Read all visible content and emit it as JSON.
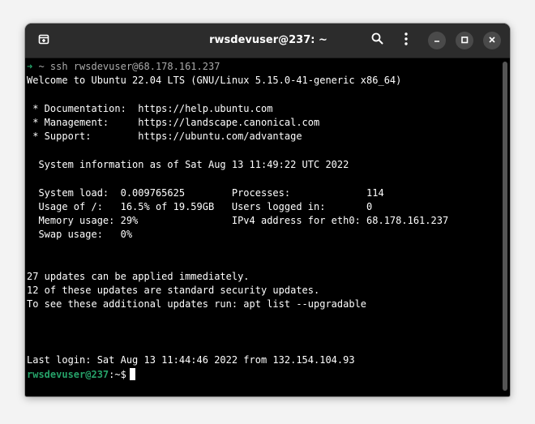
{
  "window": {
    "title": "rwsdevuser@237: ~"
  },
  "terminal": {
    "ssh_arrow": "➜",
    "ssh_command": " ~ ssh rwsdevuser@68.178.161.237",
    "welcome": "Welcome to Ubuntu 22.04 LTS (GNU/Linux 5.15.0-41-generic x86_64)",
    "doc_line": " * Documentation:  https://help.ubuntu.com",
    "mgmt_line": " * Management:     https://landscape.canonical.com",
    "support_line": " * Support:        https://ubuntu.com/advantage",
    "sysinfo_header": "  System information as of Sat Aug 13 11:49:22 UTC 2022",
    "stats_line1": "  System load:  0.009765625        Processes:             114",
    "stats_line2": "  Usage of /:   16.5% of 19.59GB   Users logged in:       0",
    "stats_line3": "  Memory usage: 29%                IPv4 address for eth0: 68.178.161.237",
    "stats_line4": "  Swap usage:   0%",
    "updates_line1": "27 updates can be applied immediately.",
    "updates_line2": "12 of these updates are standard security updates.",
    "updates_line3": "To see these additional updates run: apt list --upgradable",
    "last_login": "Last login: Sat Aug 13 11:44:46 2022 from 132.154.104.93",
    "prompt_user": "rwsdevuser@237",
    "prompt_path": ":~$"
  },
  "icons": {
    "new_tab": "new-tab-icon",
    "search": "search-icon",
    "menu": "kebab-menu-icon",
    "minimize": "minimize-icon",
    "maximize": "maximize-icon",
    "close": "close-icon"
  },
  "colors": {
    "prompt_green": "#26a269",
    "background": "#000000",
    "titlebar": "#2c2c2c"
  }
}
